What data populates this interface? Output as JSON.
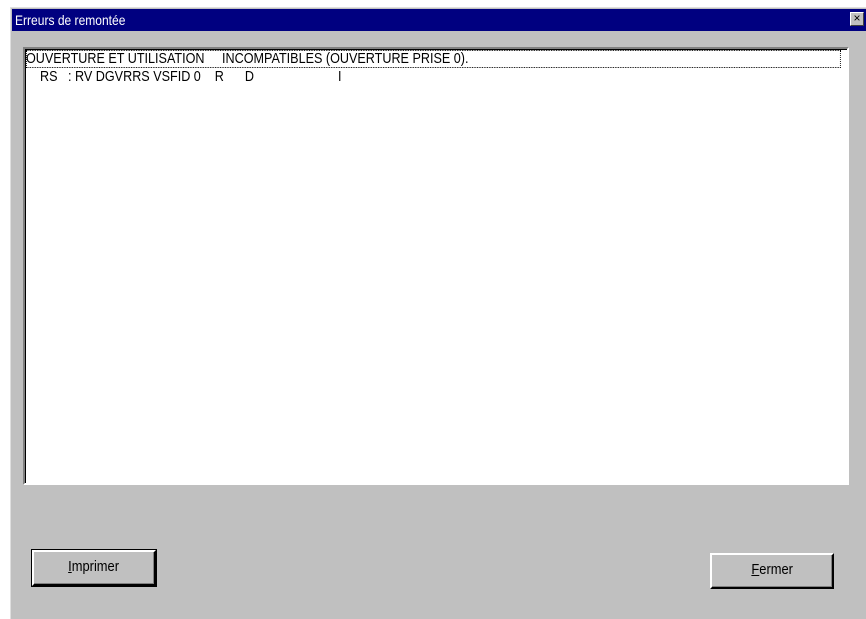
{
  "window": {
    "title": "Erreurs de remontée",
    "close_glyph": "×"
  },
  "list": {
    "rows": [
      "OUVERTURE ET UTILISATION     INCOMPATIBLES (OUVERTURE PRISE 0).",
      "    RS   : RV DGVRRS VSFID 0    R      D                        I"
    ]
  },
  "buttons": {
    "print_label": "Imprimer",
    "close_label": "Fermer"
  },
  "colors": {
    "titlebar": "#000080",
    "face": "#c0c0c0"
  }
}
